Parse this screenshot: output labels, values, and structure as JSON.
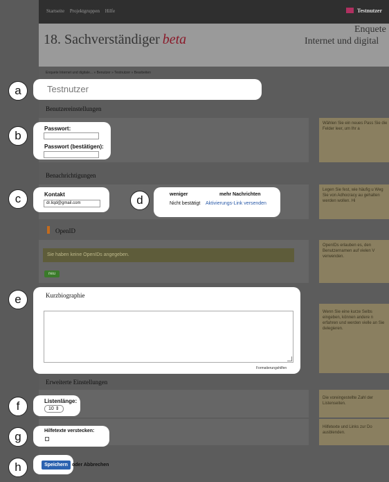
{
  "nav": {
    "items": [
      "Startseite",
      "Projektgruppen",
      "Hilfe"
    ],
    "user": "Testnutzer"
  },
  "site": {
    "title": "18. Sachverständiger",
    "beta": "beta",
    "enquete_line1": "Enquete",
    "enquete_line2": "Internet und digital"
  },
  "breadcrumb": "Enquete Internet und digitale... » Benutzer » Testnutzer » Bearbeiten",
  "display_name": {
    "value": "Testnutzer"
  },
  "sections": {
    "user_settings": "Benutzereinstellungen",
    "notifications": "Benachrichtigungen",
    "openid": "OpenID",
    "bio": "Kurzbiographie",
    "advanced": "Erweiterte Einstellungen"
  },
  "password": {
    "label": "Passwort:",
    "confirm_label": "Passwort (bestätigen):"
  },
  "contact": {
    "label": "Kontakt",
    "email": "dr.liqd@gmail.com"
  },
  "notify": {
    "less": "weniger",
    "more": "mehr Nachrichten",
    "status": "Nicht bestätigt",
    "activation_link": "Aktivierungs-Link versenden"
  },
  "openid_section": {
    "notice": "Sie haben keine OpenIDs angegeben.",
    "new_button": "neu"
  },
  "bio_section": {
    "format_help": "Formatierungshilfen"
  },
  "list_length": {
    "label": "Listenlänge:",
    "value": "10"
  },
  "hide_help": {
    "label": "Hilfetexte verstecken:"
  },
  "actions": {
    "save": "Speichern",
    "or": "oder",
    "cancel": "Abbrechen"
  },
  "help": {
    "password": "Wählen Sie ein neues Pass Sie die Felder leer, um Ihr a",
    "notifications": "Legen Sie fest, wie häufig u Weg Sie von Adhocracy au gehalten werden wollen. Hi",
    "openid": "OpenIDs erlauben es, den Benutzernamen auf vielen V verwenden.",
    "bio": "Wenn Sie eine kurze Selbs eingeben, können andere n erfahren und werden vielle an Sie delegieren.",
    "list_length": "Die voreingestellte Zahl der Listenseiten.",
    "hide_help": "Hilfetexte und Links zur Do ausblenden."
  },
  "markers": [
    "a",
    "b",
    "c",
    "d",
    "e",
    "f",
    "g",
    "h"
  ]
}
